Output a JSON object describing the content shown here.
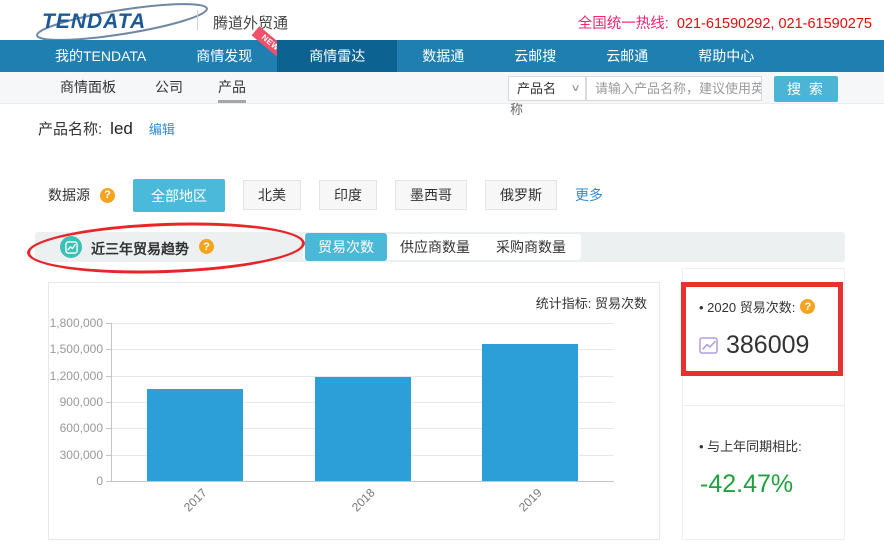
{
  "icons": {
    "help": "?",
    "chevron": "∨"
  },
  "colors": {
    "nav_blue": "#1e7fb0",
    "nav_active_blue": "#0c6392",
    "accent_cyan": "#4ab9da",
    "bar_blue": "#2d9fd8",
    "positive_green": "#1fa23d",
    "hotline_pink": "#f0256e",
    "hotline_red": "#e60b0b",
    "annotation_red": "#e8262a",
    "help_orange": "#f5a41f",
    "trend_icon_teal": "#3fc0b4"
  },
  "header": {
    "logo_text": "TENDATA",
    "brand": "腾道外贸通",
    "hotline_label": "全国统一热线:",
    "hotline_numbers": "021-61590292, 021-61590275"
  },
  "nav": {
    "items": [
      {
        "label": "我的TENDATA"
      },
      {
        "label": "商情发现",
        "badge": "NEW"
      },
      {
        "label": "商情雷达",
        "active": true
      },
      {
        "label": "数据通"
      },
      {
        "label": "云邮搜"
      },
      {
        "label": "云邮通"
      },
      {
        "label": "帮助中心"
      }
    ]
  },
  "subnav": {
    "items": [
      {
        "label": "商情面板"
      },
      {
        "label": "公司"
      },
      {
        "label": "产品",
        "active": true
      }
    ],
    "search": {
      "category": "产品名",
      "placeholder_line1": "请输入产品名称，建议使用英",
      "placeholder_overflow": "称",
      "button_label": "搜 索"
    }
  },
  "product": {
    "label": "产品名称:",
    "name": "led",
    "edit_link": "编辑"
  },
  "filters": {
    "label": "数据源",
    "regions": [
      {
        "label": "全部地区",
        "active": true
      },
      {
        "label": "北美"
      },
      {
        "label": "印度"
      },
      {
        "label": "墨西哥"
      },
      {
        "label": "俄罗斯"
      }
    ],
    "more_link": "更多"
  },
  "trend": {
    "title": "近三年贸易趋势",
    "tabs": [
      {
        "label": "贸易次数",
        "active": true
      },
      {
        "label": "供应商数量"
      },
      {
        "label": "采购商数量"
      }
    ],
    "stat_label": "统计指标: 贸易次数"
  },
  "chart_data": {
    "type": "bar",
    "title": "近三年贸易趋势",
    "series_name": "贸易次数",
    "categories": [
      "2017",
      "2018",
      "2019"
    ],
    "values": [
      1050000,
      1190000,
      1560000
    ],
    "ylim": [
      0,
      1800000
    ],
    "ytick_step": 300000,
    "ytick_labels": [
      "0",
      "300,000",
      "600,000",
      "900,000",
      "1,200,000",
      "1,500,000",
      "1,800,000"
    ],
    "bar_color": "#2d9fd8",
    "grid": true,
    "xlabel_rotation_deg": 45,
    "legend": "none"
  },
  "metrics": {
    "current": {
      "label": "• 2020 贸易次数:",
      "value": "386009"
    },
    "yoy": {
      "label": "• 与上年同期相比:",
      "value": "-42.47%"
    }
  }
}
